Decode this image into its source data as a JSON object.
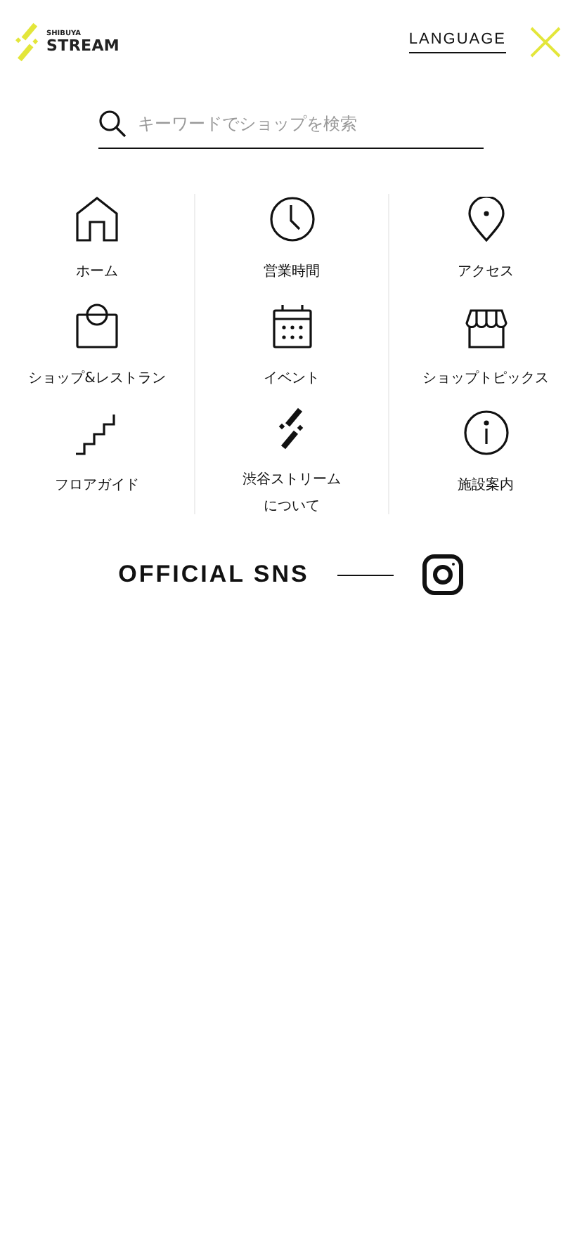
{
  "header": {
    "logo_small": "SHIBUYA",
    "logo_main": "STREAM",
    "language": "LANGUAGE"
  },
  "search": {
    "placeholder": "キーワードでショップを検索"
  },
  "menu": [
    {
      "kind": "home",
      "lines": [
        "ホーム"
      ]
    },
    {
      "kind": "clock",
      "lines": [
        "営業時間"
      ]
    },
    {
      "kind": "pin",
      "lines": [
        "アクセス"
      ]
    },
    {
      "kind": "bag",
      "lines": [
        "ショップ&レストラン"
      ]
    },
    {
      "kind": "calendar",
      "lines": [
        "イベント"
      ]
    },
    {
      "kind": "store",
      "lines": [
        "ショップトピックス"
      ]
    },
    {
      "kind": "stairs",
      "lines": [
        "フロアガイド"
      ]
    },
    {
      "kind": "brand",
      "lines": [
        "渋谷ストリーム",
        "について"
      ]
    },
    {
      "kind": "info",
      "lines": [
        "施設案内"
      ]
    }
  ],
  "sns": {
    "title": "OFFICIAL SNS"
  }
}
